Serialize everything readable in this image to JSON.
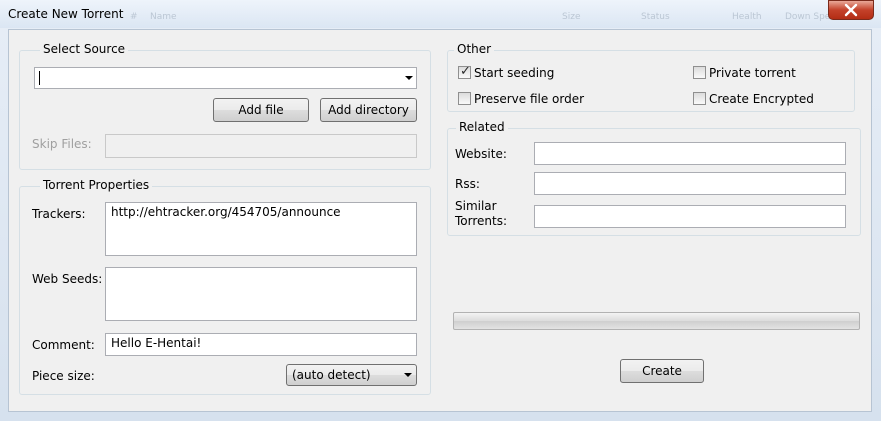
{
  "window": {
    "title": "Create New Torrent",
    "background_columns": [
      "#",
      "Name",
      "Size",
      "Status",
      "Health",
      "Down Speed"
    ]
  },
  "select_source": {
    "legend": "Select Source",
    "path_value": "",
    "add_file_label": "Add file",
    "add_directory_label": "Add directory",
    "skip_files_label": "Skip Files:",
    "skip_files_value": ""
  },
  "torrent_properties": {
    "legend": "Torrent Properties",
    "trackers_label": "Trackers:",
    "trackers_value": "http://ehtracker.org/454705/announce",
    "web_seeds_label": "Web Seeds:",
    "web_seeds_value": "",
    "comment_label": "Comment:",
    "comment_value": "Hello E-Hentai!",
    "piece_size_label": "Piece size:",
    "piece_size_value": "(auto detect)"
  },
  "other": {
    "legend": "Other",
    "start_seeding": {
      "label": "Start seeding",
      "checked": true
    },
    "preserve_file_order": {
      "label": "Preserve file order",
      "checked": false
    },
    "private_torrent": {
      "label": "Private torrent",
      "checked": false
    },
    "create_encrypted": {
      "label": "Create Encrypted",
      "checked": false
    }
  },
  "related": {
    "legend": "Related",
    "website_label": "Website:",
    "website_value": "",
    "rss_label": "Rss:",
    "rss_value": "",
    "similar_label_line1": "Similar",
    "similar_label_line2": "Torrents:",
    "similar_value": ""
  },
  "progress": {
    "value": 0
  },
  "create_label": "Create"
}
